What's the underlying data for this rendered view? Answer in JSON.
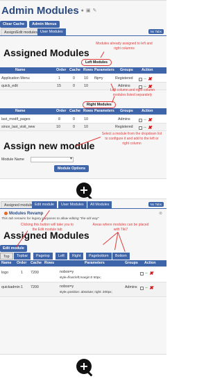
{
  "panel1": {
    "title": "Admin Modules",
    "title_icons": [
      "help-icon",
      "toggle-icon",
      "edit-icon"
    ],
    "buttons": [
      "Clear Cache",
      "Admin Menus"
    ],
    "tabs": [
      {
        "label": "Assign/Edit modules",
        "active": false
      },
      {
        "label": "User Modules",
        "active": true
      }
    ],
    "notabs_label": "No Tabs",
    "heading": "Assigned Modules",
    "annotations": {
      "top": "Modules already assigned to left and right columns",
      "middle": "Left column and right column modules listed separately",
      "bottom": "Select a module from the dropdown list to configure it and add to the left or right column"
    },
    "left_label": "Left Modules",
    "right_label": "Right Modules",
    "columns": [
      "Name",
      "Order",
      "Cache",
      "Rows",
      "Parameters",
      "Groups",
      "Action"
    ],
    "left_rows": [
      {
        "name": "Application Menu",
        "order": "1",
        "cache": "0",
        "rows": "10",
        "params": "flip=y",
        "groups": "Registered"
      },
      {
        "name": "quick_edit",
        "order": "15",
        "cache": "0",
        "rows": "10",
        "params": "",
        "groups": "Admins"
      }
    ],
    "right_rows": [
      {
        "name": "last_modif_pages",
        "order": "8",
        "cache": "0",
        "rows": "10",
        "params": "",
        "groups": "Admins"
      },
      {
        "name": "since_last_visit_new",
        "order": "10",
        "cache": "0",
        "rows": "10",
        "params": "",
        "groups": "Registered"
      }
    ],
    "assign_heading": "Assign new module",
    "module_name_label": "Module Name",
    "module_options_label": "Module Options"
  },
  "panel2": {
    "tabs": [
      {
        "label": "Assigned modules",
        "active": false
      },
      {
        "label": "Edit module",
        "active": true
      },
      {
        "label": "User Modules",
        "active": false
      },
      {
        "label": "All Modules",
        "active": false
      }
    ],
    "notabs_label": "No Tabs",
    "revamp_title": "Modules Revamp",
    "italic_note": "This tab remains for legacy purposes to allow editing \"the old way\"",
    "heading": "Assigned Modules",
    "edit_button": "Edit module",
    "annotations": {
      "left": "Clicking this button will take you to the Edit module tab",
      "right": "Areas where modules can be placed with Tiki7"
    },
    "subtabs": [
      "Top",
      "Topbar",
      "Pagetop",
      "Left",
      "Right",
      "Pagebottom",
      "Bottom"
    ],
    "selected_subtab": "Top",
    "columns": [
      "Name",
      "Order",
      "Cache",
      "Rows",
      "Parameters",
      "Groups",
      "Action"
    ],
    "rows": [
      {
        "name": "logo",
        "order": "1",
        "cache": "7200",
        "params1": "nobox=y",
        "params2": "style=float:left;margin:0 50px;",
        "groups": ""
      },
      {
        "name": "quickadmin",
        "order": "1",
        "cache": "7200",
        "params1": "nobox=y",
        "params2": "style=position: absolute; right: 200px;",
        "groups": "Admins"
      }
    ]
  }
}
